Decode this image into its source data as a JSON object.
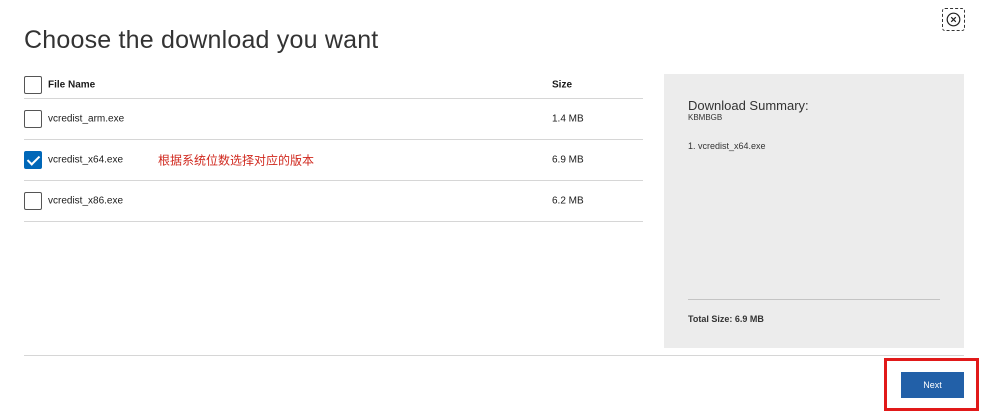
{
  "dialog": {
    "title": "Choose the download you want",
    "close_icon": "close-icon"
  },
  "table": {
    "headers": {
      "name": "File Name",
      "size": "Size"
    },
    "rows": [
      {
        "name": "vcredist_arm.exe",
        "size": "1.4 MB",
        "checked": false
      },
      {
        "name": "vcredist_x64.exe",
        "size": "6.9 MB",
        "checked": true
      },
      {
        "name": "vcredist_x86.exe",
        "size": "6.2 MB",
        "checked": false
      }
    ],
    "annotation": "根据系统位数选择对应的版本"
  },
  "summary": {
    "title": "Download Summary:",
    "subtitle": "KBMBGB",
    "items": [
      "1. vcredist_x64.exe"
    ],
    "total": "Total Size: 6.9 MB"
  },
  "footer": {
    "next_label": "Next"
  },
  "colors": {
    "accent": "#0067b8",
    "button": "#2260a8",
    "annotation": "#d0281e",
    "highlight": "#e11919",
    "summary_bg": "#ececec"
  }
}
